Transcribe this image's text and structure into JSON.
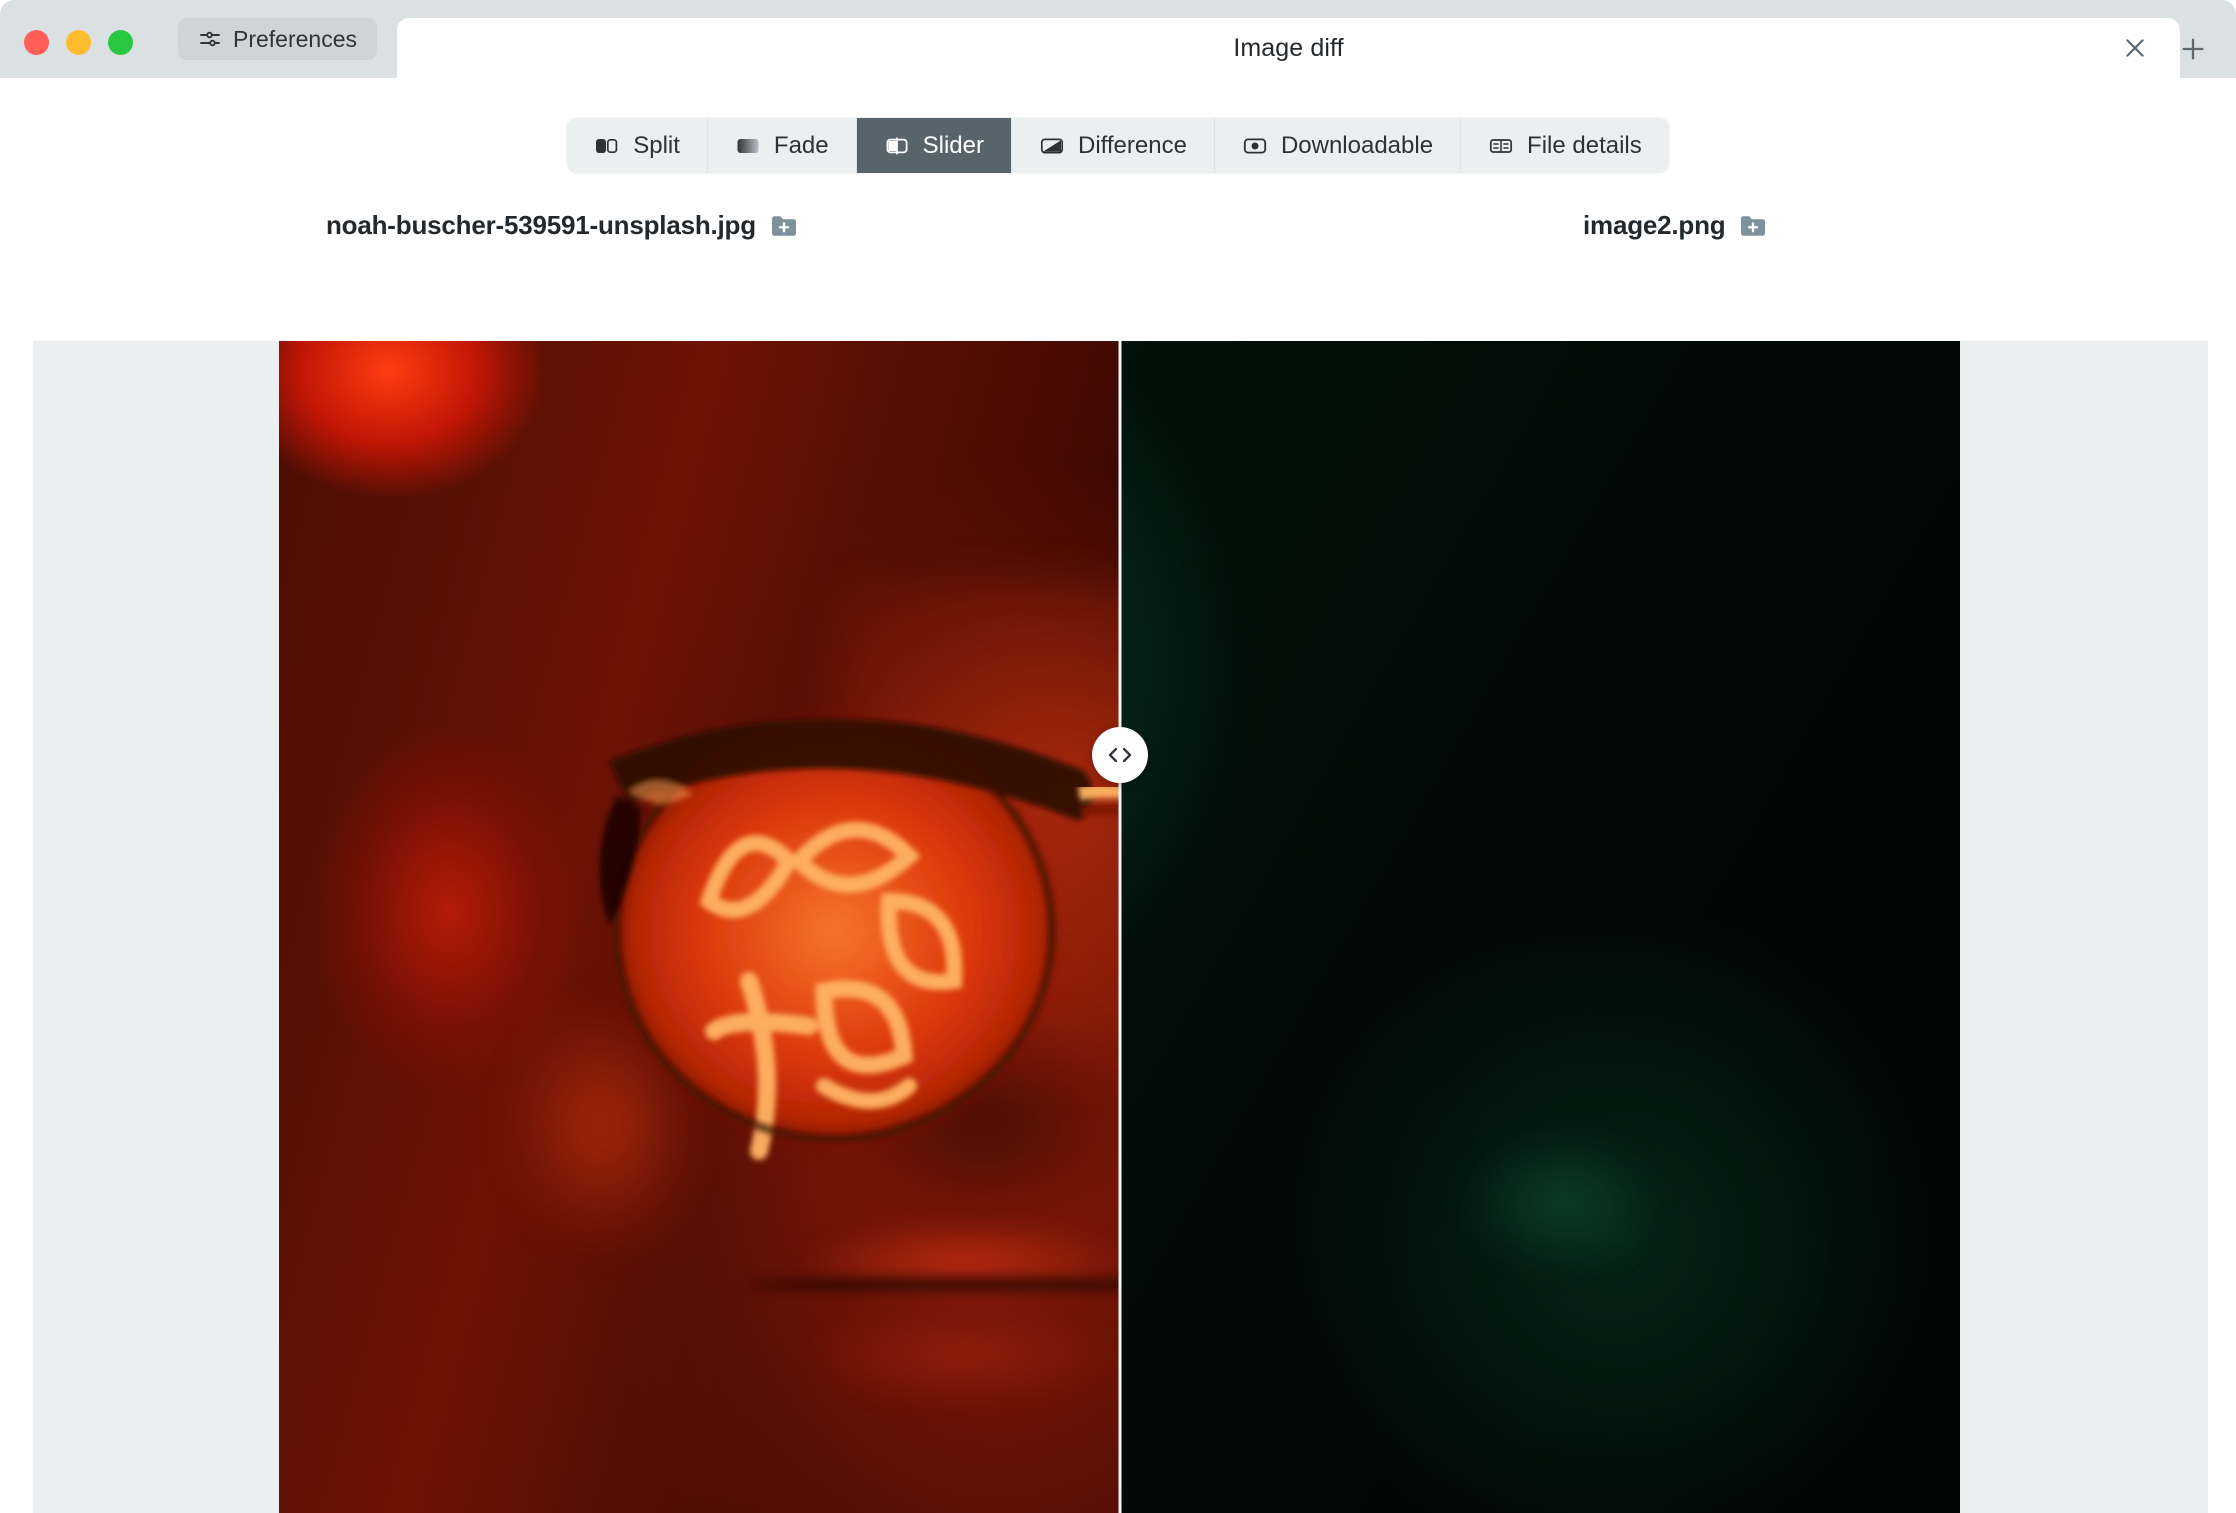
{
  "window": {
    "traffic_lights": [
      "close",
      "minimize",
      "maximize"
    ],
    "preferences_label": "Preferences",
    "preferences_icon": "sliders-icon",
    "new_tab_icon": "plus-icon",
    "close_tab_icon": "close-icon"
  },
  "tab": {
    "title": "Image diff"
  },
  "view_modes": [
    {
      "label": "Split",
      "icon": "split-icon",
      "active": false
    },
    {
      "label": "Fade",
      "icon": "fade-icon",
      "active": false
    },
    {
      "label": "Slider",
      "icon": "slider-icon",
      "active": true
    },
    {
      "label": "Difference",
      "icon": "difference-icon",
      "active": false
    },
    {
      "label": "Downloadable",
      "icon": "downloadable-icon",
      "active": false
    },
    {
      "label": "File details",
      "icon": "file-details-icon",
      "active": false
    }
  ],
  "files": {
    "left": {
      "name": "noah-buscher-539591-unsplash.jpg",
      "add_icon": "folder-add-icon"
    },
    "right": {
      "name": "image2.png",
      "add_icon": "folder-add-icon"
    }
  },
  "viewer": {
    "mode": "slider",
    "slider_position_percent": 50,
    "handle_icon": "chevron-left-right-icon",
    "left_image_description": "Close-up portrait of a face wearing glasses with neon sign reflections, tinted red",
    "right_image_description": "Same portrait tinted dark green, mostly black background"
  },
  "colors": {
    "titlebar": "#dbe1e3",
    "active_tab_bg": "#57646c",
    "segment_bg": "#eceff0",
    "canvas_bg": "#eceff0",
    "text": "#2c3236",
    "folder_icon": "#7e929c"
  }
}
